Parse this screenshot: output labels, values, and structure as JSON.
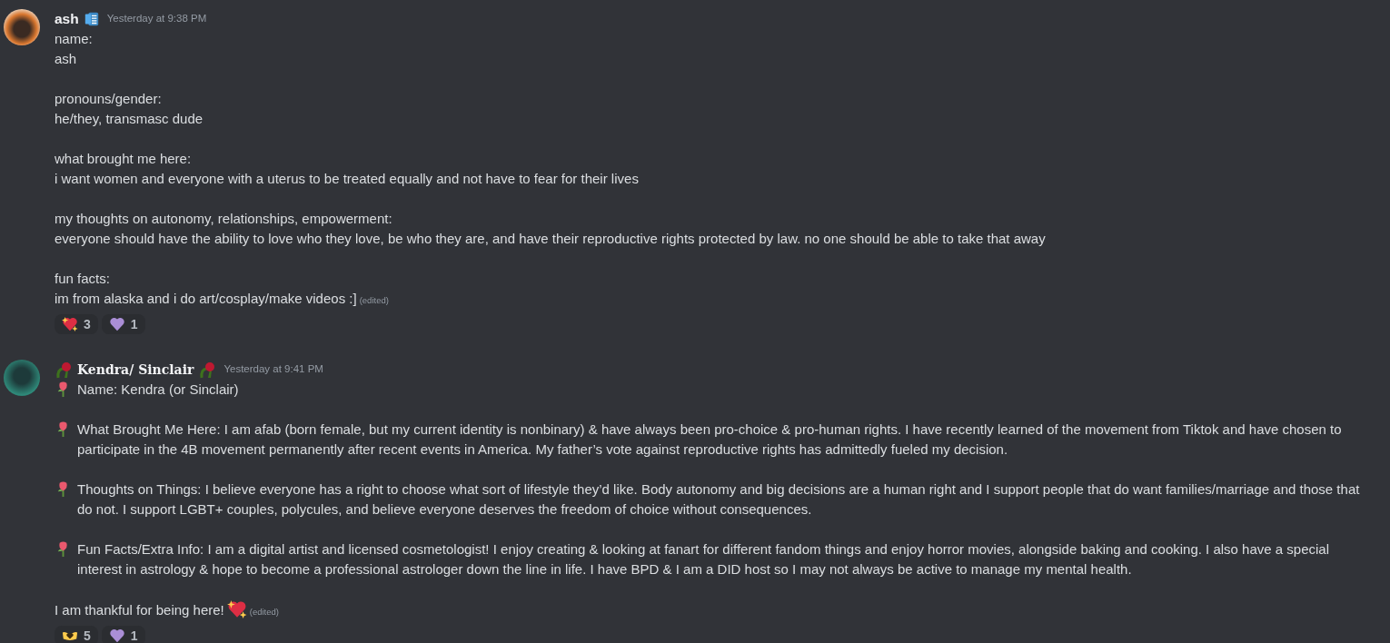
{
  "messages": [
    {
      "author": "ash",
      "kind": "plain",
      "timestamp": "Yesterday at 9:38 PM",
      "paragraphs": [
        {
          "bullet": false,
          "lines": [
            "name:",
            "ash"
          ]
        },
        {
          "bullet": false,
          "lines": [
            "pronouns/gender:",
            "he/they, transmasc dude"
          ]
        },
        {
          "bullet": false,
          "lines": [
            "what brought me here:",
            "i want women and everyone with a uterus to be treated equally and not have to fear for their lives"
          ]
        },
        {
          "bullet": false,
          "lines": [
            "my thoughts on autonomy, relationships, empowerment:",
            "everyone should have the ability to love who they love, be who they are, and have their reproductive rights protected by law. no one should be able to take that away"
          ]
        },
        {
          "bullet": false,
          "lines": [
            "fun facts:",
            "im from alaska and i do art/cosplay/make videos :]"
          ]
        }
      ],
      "trailing_emoji": false,
      "edited": "(edited)",
      "reactions": [
        {
          "kind": "sparkle-heart",
          "count": "3"
        },
        {
          "kind": "purple-heart",
          "count": "1"
        }
      ]
    },
    {
      "author": "Kendra/ Sinclair",
      "kind": "decorated",
      "timestamp": "Yesterday at 9:41 PM",
      "paragraphs": [
        {
          "bullet": true,
          "lines": [
            "Name: Kendra (or Sinclair)"
          ]
        },
        {
          "bullet": true,
          "lines": [
            "What Brought Me Here: I am afab (born female, but my current identity is nonbinary) & have always been pro-choice & pro-human rights. I have recently learned of the movement from Tiktok and have chosen to participate in the 4B movement permanently after recent events in America. My father’s vote against reproductive rights has admittedly fueled my decision."
          ]
        },
        {
          "bullet": true,
          "lines": [
            "Thoughts on Things: I believe everyone has a right to choose what sort of lifestyle they’d like. Body autonomy and big decisions are a human right and I support people that do want families/marriage and those that do not. I support LGBT+ couples, polycules, and believe everyone deserves the freedom of choice without consequences."
          ]
        },
        {
          "bullet": true,
          "lines": [
            "Fun Facts/Extra Info: I am a digital artist and licensed cosmetologist! I enjoy creating & looking at fanart for different fandom things and enjoy horror movies, alongside baking and cooking. I also have a special interest in astrology & hope to become a professional astrologer down the line in life. I have BPD & I am a DID host so I may not always be active to manage my mental health."
          ]
        },
        {
          "bullet": false,
          "lines": [
            "I am thankful for being here!"
          ]
        }
      ],
      "trailing_emoji": true,
      "edited": "(edited)",
      "reactions": [
        {
          "kind": "heart-hands",
          "count": "5"
        },
        {
          "kind": "purple-heart",
          "count": "1"
        }
      ]
    }
  ]
}
